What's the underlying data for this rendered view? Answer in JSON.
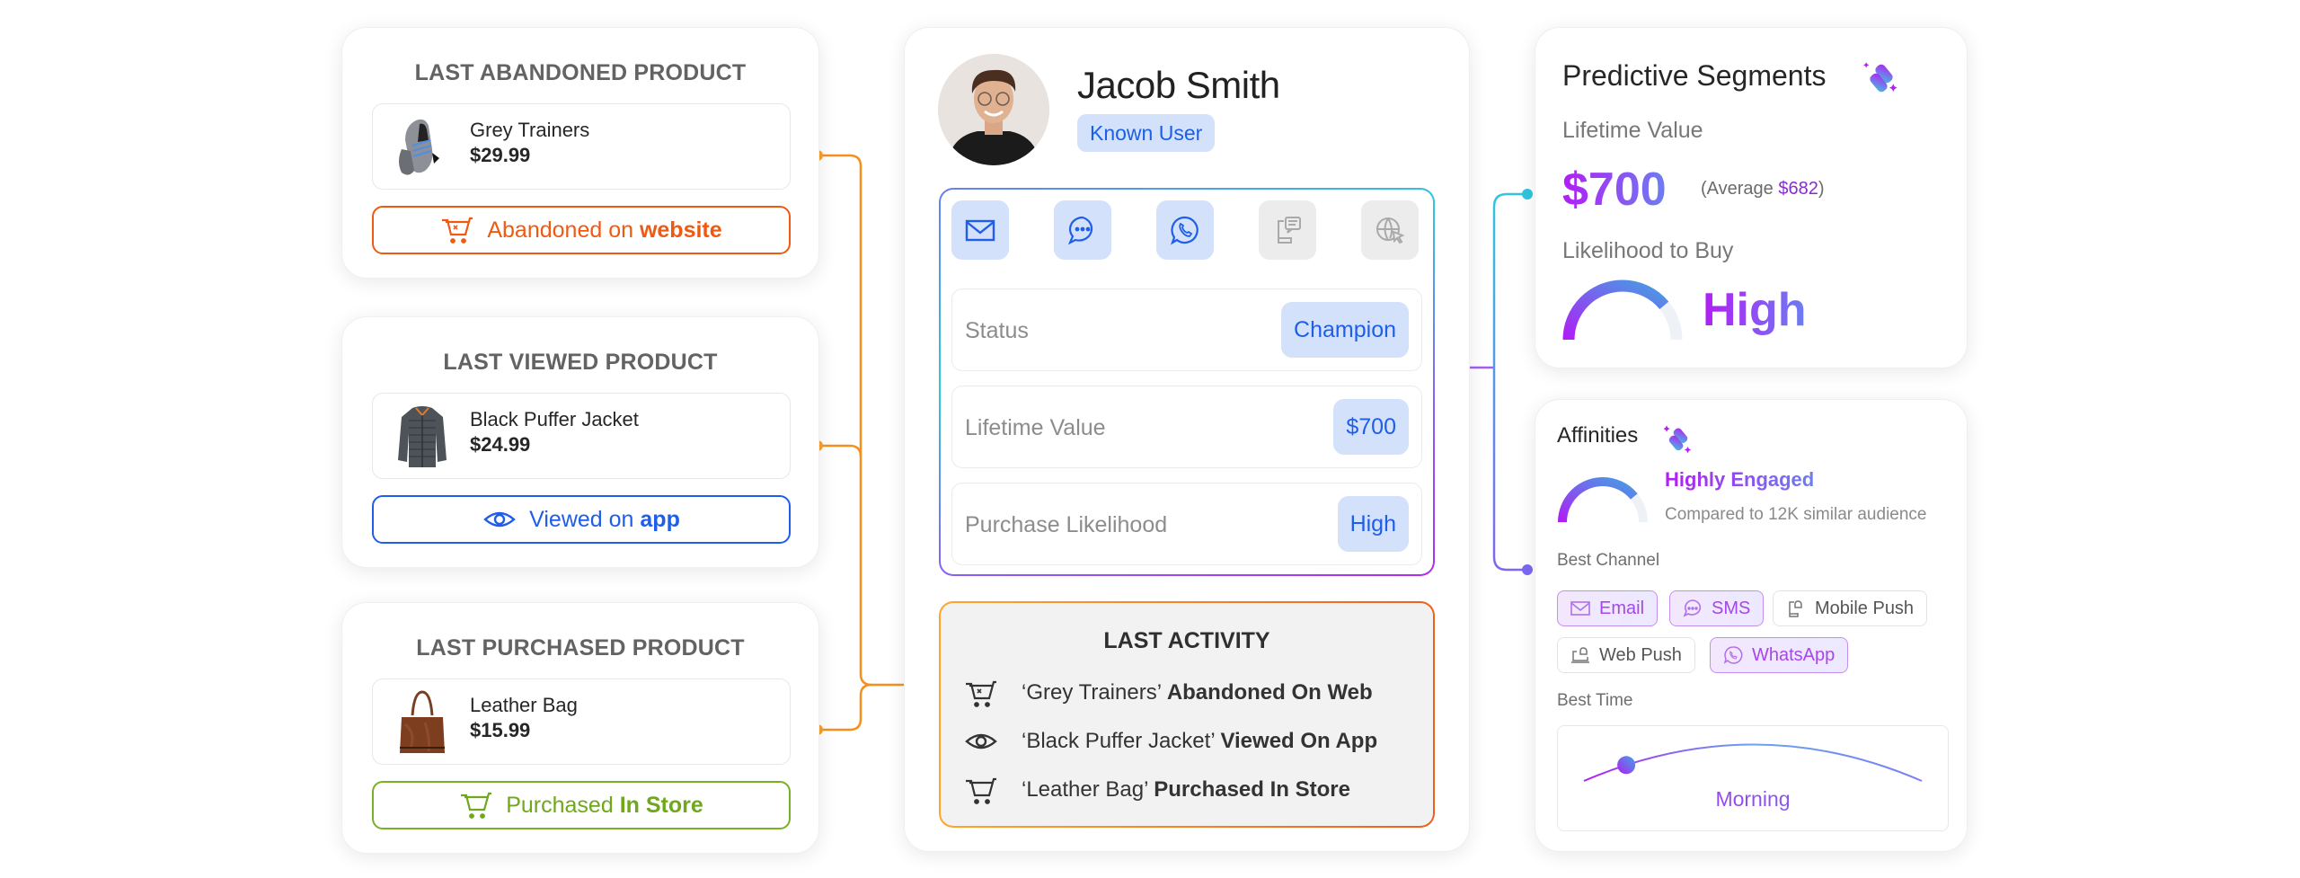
{
  "products": [
    {
      "section_title": "LAST ABANDONED PRODUCT",
      "name": "Grey Trainers",
      "price": "$29.99",
      "tag_prefix": "Abandoned on ",
      "tag_bold": "website",
      "tag_icon": "cart-x-icon",
      "tag_color": "#ef5a12",
      "thumb": "sneakers"
    },
    {
      "section_title": "LAST VIEWED PRODUCT",
      "name": "Black Puffer Jacket",
      "price": "$24.99",
      "tag_prefix": "Viewed on ",
      "tag_bold": "app",
      "tag_icon": "eye-icon",
      "tag_color": "#1f5ee8",
      "thumb": "jacket"
    },
    {
      "section_title": "LAST PURCHASED PRODUCT",
      "name": "Leather Bag",
      "price": "$15.99",
      "tag_prefix": "Purchased ",
      "tag_bold": "In Store",
      "tag_icon": "cart-icon",
      "tag_color": "#6fa81a",
      "thumb": "bag"
    }
  ],
  "profile": {
    "name": "Jacob Smith",
    "badge": "Known User",
    "channels": [
      {
        "icon": "email-icon",
        "active": true
      },
      {
        "icon": "sms-chat-icon",
        "active": true
      },
      {
        "icon": "whatsapp-icon",
        "active": true
      },
      {
        "icon": "mobile-push-icon",
        "active": false
      },
      {
        "icon": "web-push-icon",
        "active": false
      }
    ],
    "stats": [
      {
        "label": "Status",
        "value": "Champion"
      },
      {
        "label": "Lifetime Value",
        "value": "$700"
      },
      {
        "label": "Purchase Likelihood",
        "value": "High"
      }
    ]
  },
  "last_activity": {
    "title": "LAST ACTIVITY",
    "items": [
      {
        "icon": "cart-x-icon",
        "product": "‘Grey Trainers’ ",
        "action": "Abandoned On Web"
      },
      {
        "icon": "eye-icon",
        "product": "‘Black Puffer Jacket’ ",
        "action": "Viewed On App"
      },
      {
        "icon": "cart-icon",
        "product": "‘Leather Bag’ ",
        "action": "Purchased In Store"
      }
    ]
  },
  "predictive": {
    "title": "Predictive Segments",
    "ltv_label": "Lifetime Value",
    "ltv_value": "$700",
    "avg_prefix": "(Average ",
    "avg_value": "$682",
    "avg_suffix": ")",
    "likelihood_label": "Likelihood to Buy",
    "likelihood_value": "High",
    "likelihood_gauge_fraction": 0.78
  },
  "affinities": {
    "title": "Affinities",
    "engagement": "Highly Engaged",
    "engagement_sub": "Compared to 12K similar audience",
    "engagement_gauge_fraction": 0.78,
    "best_channel_label": "Best Channel",
    "channels": [
      {
        "label": "Email",
        "icon": "email-icon",
        "highlighted": true
      },
      {
        "label": "SMS",
        "icon": "sms-chat-icon",
        "highlighted": true
      },
      {
        "label": "Mobile Push",
        "icon": "mobile-push-icon",
        "highlighted": false
      },
      {
        "label": "Web Push",
        "icon": "web-push-icon",
        "highlighted": false
      },
      {
        "label": "WhatsApp",
        "icon": "whatsapp-icon",
        "highlighted": true
      }
    ],
    "best_time_label": "Best Time",
    "best_time_value": "Morning",
    "best_time_position_fraction": 0.13
  }
}
